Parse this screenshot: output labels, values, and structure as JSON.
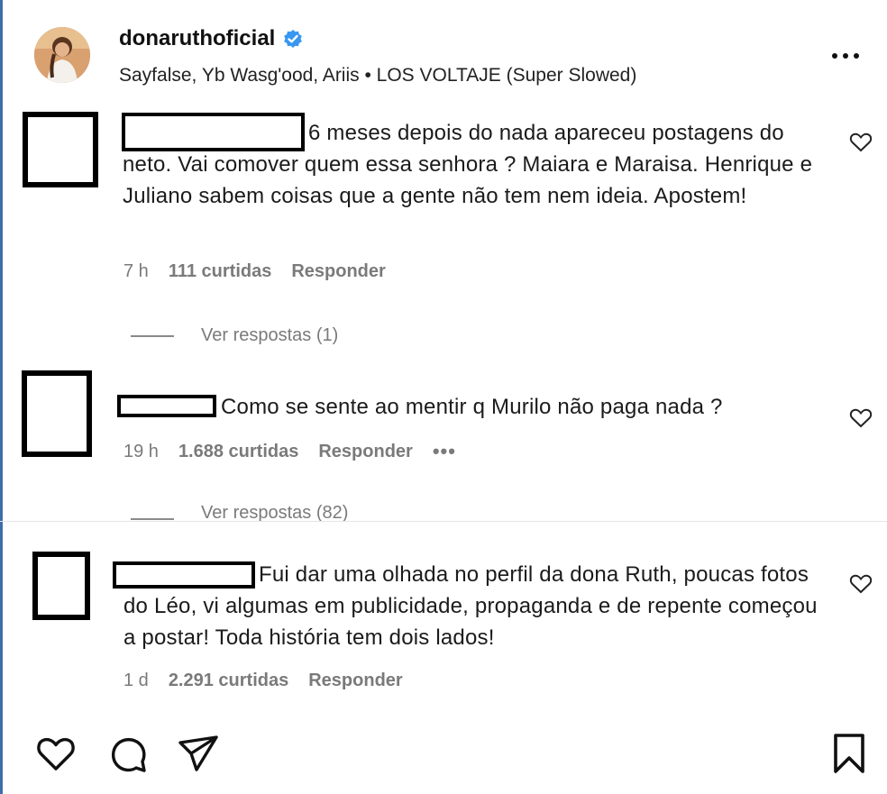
{
  "post": {
    "username": "donaruthoficial",
    "verified": true,
    "audio": "Sayfalse, Yb Wasg'ood, Ariis • LOS VOLTAJE (Super Slowed)"
  },
  "comments": [
    {
      "text": "6 meses depois do nada apareceu postagens do neto. Vai comover quem essa senhora ? Maiara e Maraisa. Henrique e Juliano sabem coisas que a gente não tem nem ideia. Apostem!",
      "time": "7 h",
      "likes": "111 curtidas",
      "reply": "Responder",
      "view_replies": "Ver respostas (1)"
    },
    {
      "text": "Como se sente ao mentir q Murilo não paga nada ?",
      "time": "19 h",
      "likes": "1.688 curtidas",
      "reply": "Responder",
      "more": "•••",
      "view_replies": "Ver respostas (82)"
    },
    {
      "text": "Fui dar uma olhada no perfil da dona Ruth, poucas fotos do Léo, vi algumas em publicidade, propaganda e de repente começou a postar! Toda história tem dois lados!",
      "time": "1 d",
      "likes": "2.291 curtidas",
      "reply": "Responder"
    }
  ],
  "icons": {
    "like": "heart-icon",
    "comment": "comment-bubble-icon",
    "share": "paper-plane-icon",
    "save": "bookmark-icon",
    "more": "more-dots-icon",
    "verified": "verified-badge-icon"
  },
  "colors": {
    "verified": "#3897f0",
    "meta_text": "#7a7a7a",
    "text": "#1b1b1b"
  }
}
